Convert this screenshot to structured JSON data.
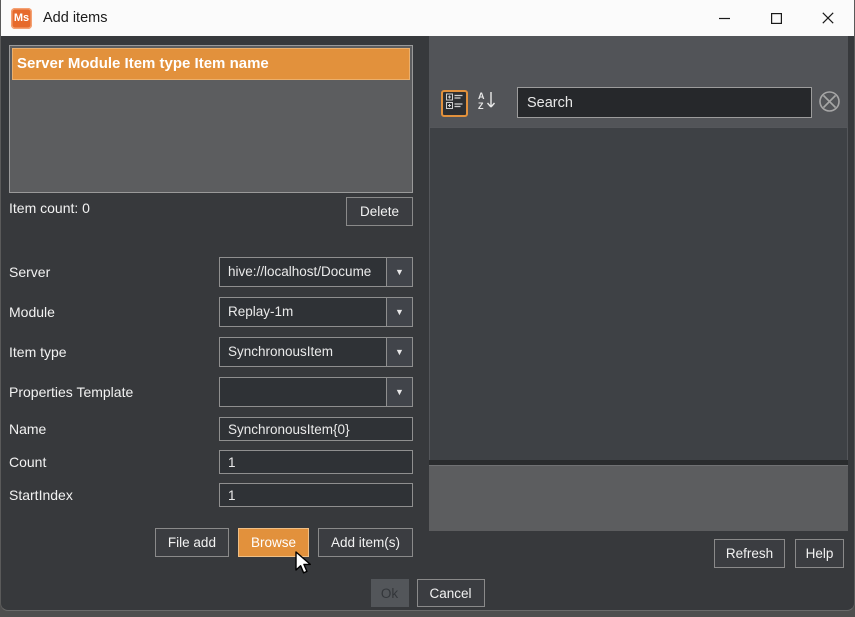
{
  "window": {
    "title": "Add items",
    "app_icon_text": "Ms"
  },
  "left_panel": {
    "list_header": "Server Module Item type Item name",
    "item_count": "Item count: 0",
    "delete_button": "Delete",
    "form": {
      "server": {
        "label": "Server",
        "value": "hive://localhost/Docume"
      },
      "module": {
        "label": "Module",
        "value": "Replay-1m"
      },
      "item_type": {
        "label": "Item type",
        "value": "SynchronousItem"
      },
      "properties_template": {
        "label": "Properties Template",
        "value": ""
      },
      "name": {
        "label": "Name",
        "value": "SynchronousItem{0}"
      },
      "count": {
        "label": "Count",
        "value": "1"
      },
      "start_index": {
        "label": "StartIndex",
        "value": "1"
      }
    },
    "actions": {
      "file_add": "File add",
      "browse": "Browse",
      "add_items": "Add item(s)"
    }
  },
  "right_panel": {
    "search_placeholder": "Search",
    "refresh_button": "Refresh",
    "help_button": "Help"
  },
  "footer": {
    "ok_button": "Ok",
    "cancel_button": "Cancel"
  },
  "icons": {
    "dropdown_arrow": "▼"
  },
  "colors": {
    "accent_orange": "#E2913C",
    "logo_orange": "#E66A2C",
    "titlebar_bg": "#FBFBFB",
    "dialog_bg": "#37393C",
    "panel_gray": "#5C5D5F",
    "toolbar_gray": "#525458",
    "tree_bg": "#3E4145",
    "input_bg": "#2F3236"
  }
}
